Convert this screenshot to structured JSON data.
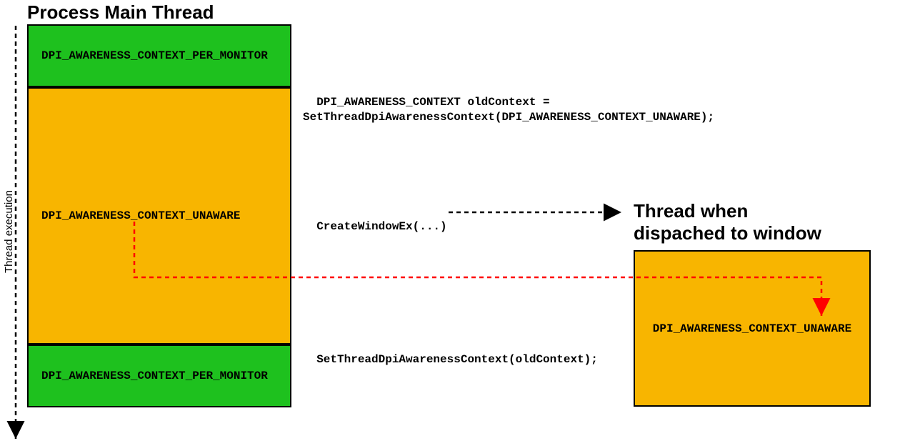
{
  "titles": {
    "main": "Process Main Thread",
    "right": "Thread when\ndispached to window"
  },
  "leftLabel": "Thread execution",
  "boxes": {
    "topGreen": "DPI_AWARENESS_CONTEXT_PER_MONITOR",
    "midOrange": "DPI_AWARENESS_CONTEXT_UNAWARE",
    "botGreen": "DPI_AWARENESS_CONTEXT_PER_MONITOR",
    "rightOrange": "DPI_AWARENESS_CONTEXT_UNAWARE"
  },
  "annotations": {
    "a1": "DPI_AWARENESS_CONTEXT oldContext =\nSetThreadDpiAwarenessContext(DPI_AWARENESS_CONTEXT_UNAWARE);",
    "a2": "CreateWindowEx(...)",
    "a3": "SetThreadDpiAwarenessContext(oldContext);"
  }
}
